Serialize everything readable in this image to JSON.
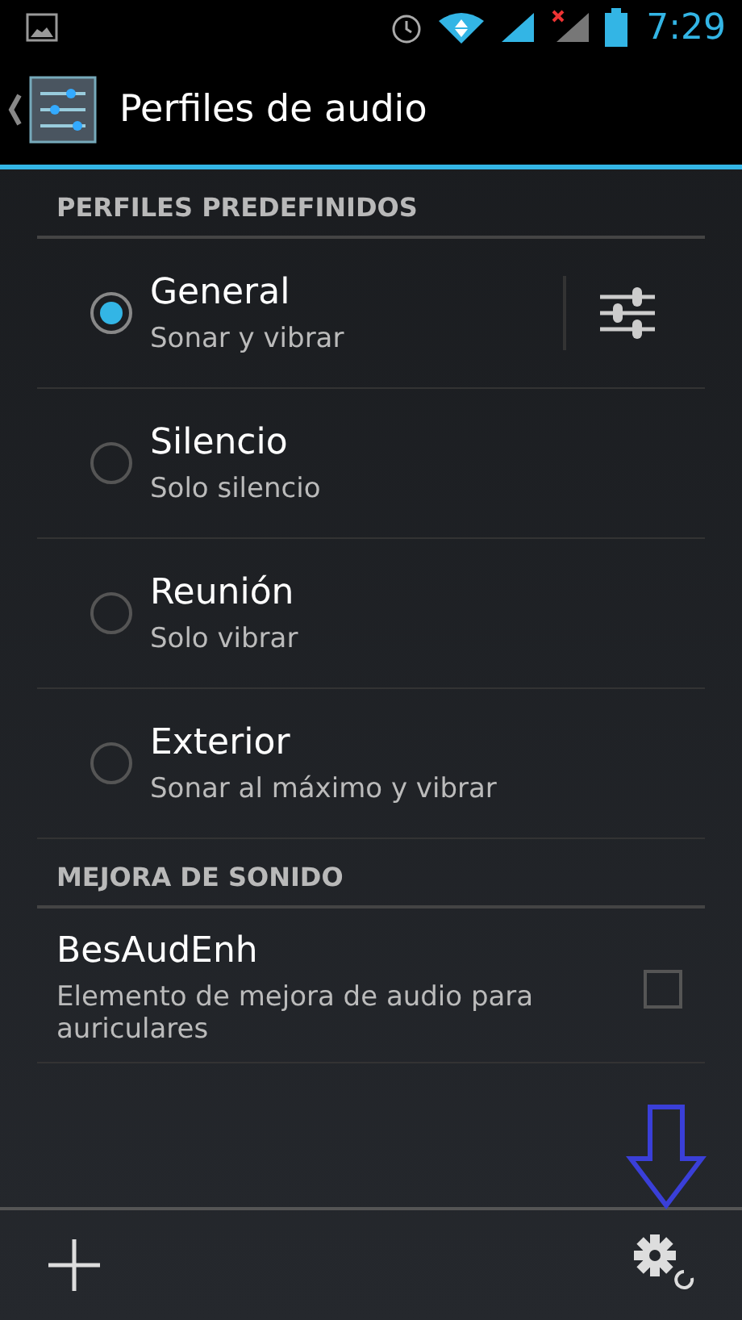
{
  "status_bar": {
    "time": "7:29"
  },
  "action_bar": {
    "title": "Perfiles de audio"
  },
  "sections": [
    {
      "header": "PERFILES PREDEFINIDOS",
      "items": [
        {
          "kind": "radio",
          "title": "General",
          "summary": "Sonar y vibrar",
          "selected": true,
          "settings": true
        },
        {
          "kind": "radio",
          "title": "Silencio",
          "summary": "Solo silencio",
          "selected": false,
          "settings": false
        },
        {
          "kind": "radio",
          "title": "Reunión",
          "summary": "Solo vibrar",
          "selected": false,
          "settings": false
        },
        {
          "kind": "radio",
          "title": "Exterior",
          "summary": "Sonar al máximo y vibrar",
          "selected": false,
          "settings": false
        }
      ]
    },
    {
      "header": "MEJORA DE SONIDO",
      "items": [
        {
          "kind": "checkbox",
          "title": "BesAudEnh",
          "summary": "Elemento de mejora de audio para auriculares",
          "checked": false
        }
      ]
    }
  ]
}
